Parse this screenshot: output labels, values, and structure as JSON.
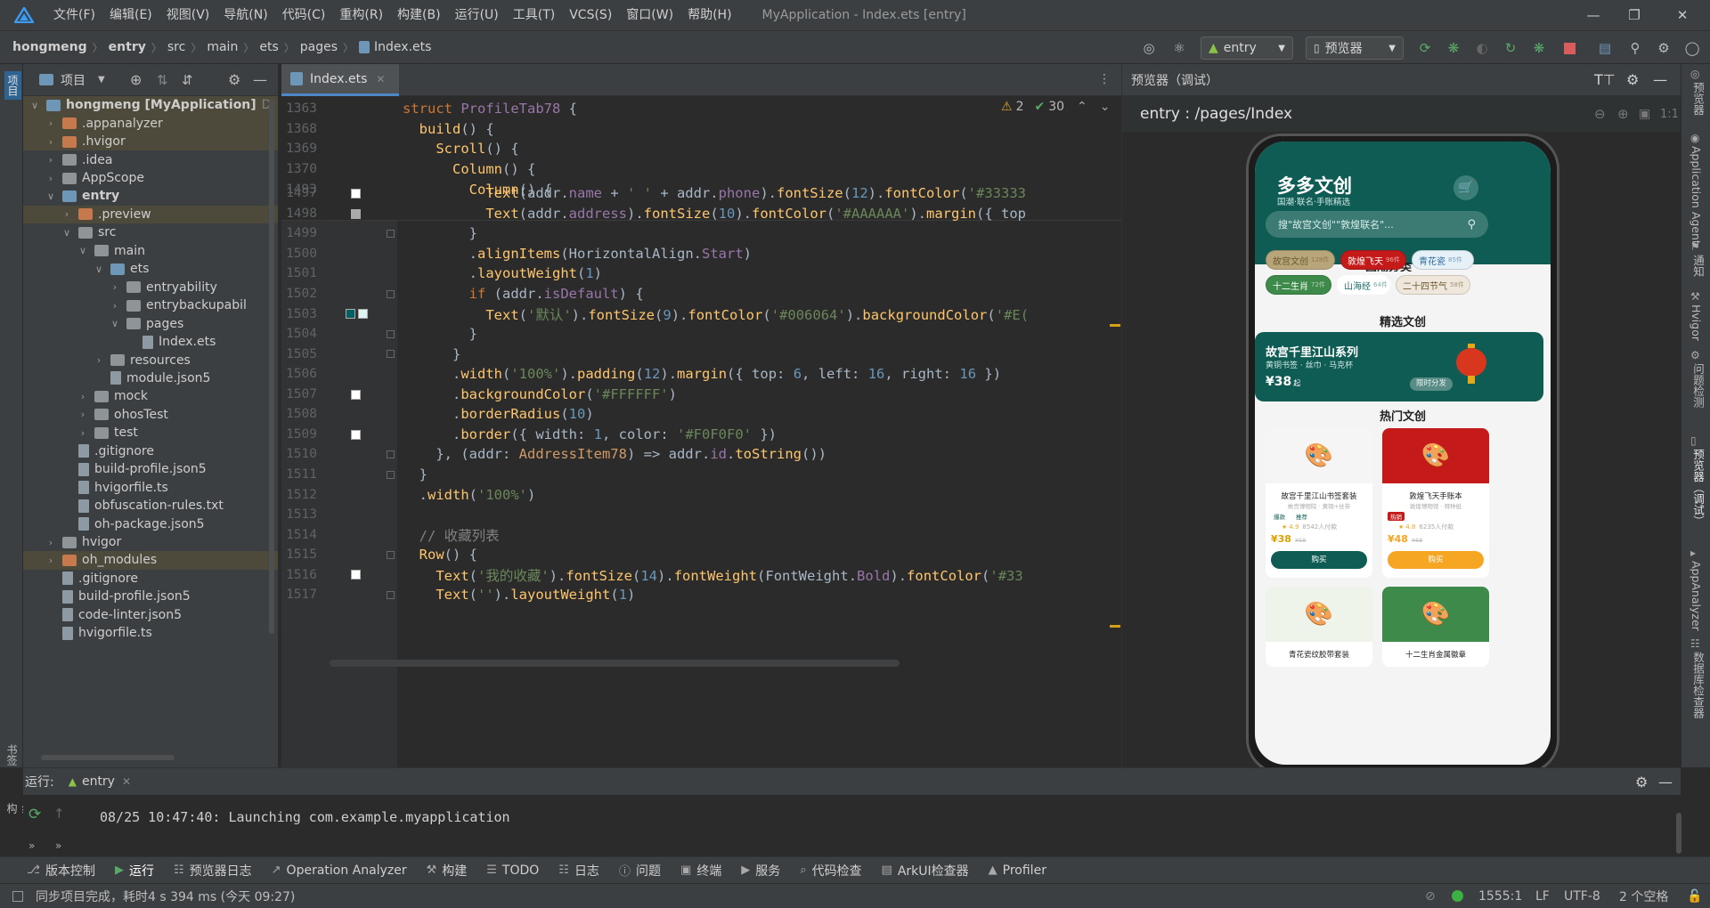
{
  "window": {
    "title": "MyApplication - Index.ets [entry]",
    "menu": [
      "文件(F)",
      "编辑(E)",
      "视图(V)",
      "导航(N)",
      "代码(C)",
      "重构(R)",
      "构建(B)",
      "运行(U)",
      "工具(T)",
      "VCS(S)",
      "窗口(W)",
      "帮助(H)"
    ]
  },
  "breadcrumbs": [
    "hongmeng",
    "entry",
    "src",
    "main",
    "ets",
    "pages",
    "Index.ets"
  ],
  "toolbar": {
    "run_config": "entry",
    "device": "预览器"
  },
  "left_strip": {
    "top_label": "项目",
    "bottom_label1": "书签",
    "bottom_label2": "结构"
  },
  "project_panel": {
    "title": "项目",
    "tree": [
      {
        "label": "hongmeng [MyApplication]",
        "suffix": "D:",
        "depth": 0,
        "expanded": true,
        "icon": "fold-blue",
        "hl": true,
        "bold": true
      },
      {
        "label": ".appanalyzer",
        "depth": 1,
        "expanded": false,
        "icon": "fold-orange",
        "hl": true
      },
      {
        "label": ".hvigor",
        "depth": 1,
        "expanded": false,
        "icon": "fold-orange",
        "hl": true
      },
      {
        "label": ".idea",
        "depth": 1,
        "expanded": false,
        "icon": "fold-gray"
      },
      {
        "label": "AppScope",
        "depth": 1,
        "expanded": false,
        "icon": "fold-gray"
      },
      {
        "label": "entry",
        "depth": 1,
        "expanded": true,
        "icon": "fold-blue",
        "bold": true
      },
      {
        "label": ".preview",
        "depth": 2,
        "expanded": false,
        "icon": "fold-orange",
        "hl": true
      },
      {
        "label": "src",
        "depth": 2,
        "expanded": true,
        "icon": "fold-gray"
      },
      {
        "label": "main",
        "depth": 3,
        "expanded": true,
        "icon": "fold-gray"
      },
      {
        "label": "ets",
        "depth": 4,
        "expanded": true,
        "icon": "fold-blue"
      },
      {
        "label": "entryability",
        "depth": 5,
        "expanded": false,
        "icon": "fold-gray"
      },
      {
        "label": "entrybackupabil",
        "depth": 5,
        "expanded": false,
        "icon": "fold-gray"
      },
      {
        "label": "pages",
        "depth": 5,
        "expanded": true,
        "icon": "fold-gray"
      },
      {
        "label": "Index.ets",
        "depth": 6,
        "leaf": true,
        "icon": "file"
      },
      {
        "label": "resources",
        "depth": 4,
        "expanded": false,
        "icon": "fold-gray"
      },
      {
        "label": "module.json5",
        "depth": 4,
        "leaf": true,
        "icon": "file"
      },
      {
        "label": "mock",
        "depth": 3,
        "expanded": false,
        "icon": "fold-gray"
      },
      {
        "label": "ohosTest",
        "depth": 3,
        "expanded": false,
        "icon": "fold-gray"
      },
      {
        "label": "test",
        "depth": 3,
        "expanded": false,
        "icon": "fold-gray"
      },
      {
        "label": ".gitignore",
        "depth": 2,
        "leaf": true,
        "icon": "file"
      },
      {
        "label": "build-profile.json5",
        "depth": 2,
        "leaf": true,
        "icon": "file"
      },
      {
        "label": "hvigorfile.ts",
        "depth": 2,
        "leaf": true,
        "icon": "file"
      },
      {
        "label": "obfuscation-rules.txt",
        "depth": 2,
        "leaf": true,
        "icon": "file"
      },
      {
        "label": "oh-package.json5",
        "depth": 2,
        "leaf": true,
        "icon": "file"
      },
      {
        "label": "hvigor",
        "depth": 1,
        "expanded": false,
        "icon": "fold-gray"
      },
      {
        "label": "oh_modules",
        "depth": 1,
        "expanded": false,
        "icon": "fold-orange",
        "hl": true
      },
      {
        "label": ".gitignore",
        "depth": 1,
        "leaf": true,
        "icon": "file"
      },
      {
        "label": "build-profile.json5",
        "depth": 1,
        "leaf": true,
        "icon": "file"
      },
      {
        "label": "code-linter.json5",
        "depth": 1,
        "leaf": true,
        "icon": "file"
      },
      {
        "label": "hvigorfile.ts",
        "depth": 1,
        "leaf": true,
        "icon": "file"
      }
    ]
  },
  "editor": {
    "tab": "Index.ets",
    "warnings": "2",
    "weak_warnings": "30",
    "sticky_lines": [
      {
        "num": "1363",
        "html": "<span class=\"kw\">struct</span> <span class=\"ty\">ProfileTab78</span> {"
      },
      {
        "num": "1368",
        "html": "  <span class=\"fn\">build</span>() {"
      },
      {
        "num": "1369",
        "html": "    <span class=\"fn\">Scroll</span>() {"
      },
      {
        "num": "1370",
        "html": "      <span class=\"fn\">Column</span>() {"
      },
      {
        "num": "1493",
        "html": "        <span class=\"fn\">Column</span>() {"
      }
    ],
    "lines": [
      {
        "num": "1497",
        "html": "          <span class=\"fn\">Text</span>(addr.<span class=\"pp\">name</span> + <span class=\"st\">' '</span> + addr.<span class=\"pp\">phone</span>).<span class=\"fn\">fontSize</span>(<span class=\"nm\">12</span>).<span class=\"fn\">fontColor</span>(<span class=\"st\">'#33333</span>"
      },
      {
        "num": "1498",
        "html": "          <span class=\"fn\">Text</span>(addr.<span class=\"pp\">address</span>).<span class=\"fn\">fontSize</span>(<span class=\"nm\">10</span>).<span class=\"fn\">fontColor</span>(<span class=\"st\">'#AAAAAA'</span>).<span class=\"fn\">margin</span>({ top"
      },
      {
        "num": "1499",
        "html": "        }"
      },
      {
        "num": "1500",
        "html": "        .<span class=\"fn\">alignItems</span>(<span class=\"pl\">HorizontalAlign</span>.<span class=\"pp\">Start</span>)"
      },
      {
        "num": "1501",
        "html": "        .<span class=\"fn\">layoutWeight</span>(<span class=\"nm\">1</span>)"
      },
      {
        "num": "1502",
        "html": "        <span class=\"kw\">if</span> (addr.<span class=\"pp\">isDefault</span>) {"
      },
      {
        "num": "1503",
        "html": "          <span class=\"fn\">Text</span>(<span class=\"st\">'默认'</span>).<span class=\"fn\">fontSize</span>(<span class=\"nm\">9</span>).<span class=\"fn\">fontColor</span>(<span class=\"st\">'#006064'</span>).<span class=\"fn\">backgroundColor</span>(<span class=\"st\">'#E(</span>"
      },
      {
        "num": "1504",
        "html": "        }"
      },
      {
        "num": "1505",
        "html": "      }"
      },
      {
        "num": "1506",
        "html": "      .<span class=\"fn\">width</span>(<span class=\"st\">'100%'</span>).<span class=\"fn\">padding</span>(<span class=\"nm\">12</span>).<span class=\"fn\">margin</span>({ top: <span class=\"nm\">6</span>, left: <span class=\"nm\">16</span>, right: <span class=\"nm\">16</span> })"
      },
      {
        "num": "1507",
        "html": "      .<span class=\"fn\">backgroundColor</span>(<span class=\"st\">'#FFFFFF'</span>)"
      },
      {
        "num": "1508",
        "html": "      .<span class=\"fn\">borderRadius</span>(<span class=\"nm\">10</span>)"
      },
      {
        "num": "1509",
        "html": "      .<span class=\"fn\">border</span>({ width: <span class=\"nm\">1</span>, color: <span class=\"st\">'#F0F0F0'</span> })"
      },
      {
        "num": "1510",
        "html": "    }, (addr: <span class=\"cl\">AddressItem78</span>) => addr.<span class=\"pp\">id</span>.<span class=\"fn\">toString</span>())"
      },
      {
        "num": "1511",
        "html": "  }"
      },
      {
        "num": "1512",
        "html": "  .<span class=\"fn\">width</span>(<span class=\"st\">'100%'</span>)"
      },
      {
        "num": "1513",
        "html": ""
      },
      {
        "num": "1514",
        "html": "  <span class=\"cm\">// 收藏列表</span>"
      },
      {
        "num": "1515",
        "html": "  <span class=\"fn\">Row</span>() {"
      },
      {
        "num": "1516",
        "html": "    <span class=\"fn\">Text</span>(<span class=\"st\">'我的收藏'</span>).<span class=\"fn\">fontSize</span>(<span class=\"nm\">14</span>).<span class=\"fn\">fontWeight</span>(<span class=\"pl\">FontWeight</span>.<span class=\"pp\">Bold</span>).<span class=\"fn\">fontColor</span>(<span class=\"st\">'#33</span>"
      },
      {
        "num": "1517",
        "html": "    <span class=\"fn\">Text</span>(<span class=\"st\">''</span>).<span class=\"fn\">layoutWeight</span>(<span class=\"nm\">1</span>)"
      }
    ]
  },
  "preview": {
    "title": "预览器（调试）",
    "path": "entry : /pages/Index",
    "app": {
      "brand": "多多文创",
      "tagline": "国潮·联名·手账精选",
      "search_placeholder": "搜\"故宫文创\"\"敦煌联名\"...",
      "tag_row1": [
        {
          "label": "故宫文创",
          "count": "128件",
          "bg": "#b8a57a",
          "fg": "#6b5a2e"
        },
        {
          "label": "敦煌飞天",
          "count": "96件",
          "bg": "#c41a1a",
          "fg": "#ffffff"
        },
        {
          "label": "青花瓷",
          "count": "85件",
          "bg": "#e6f0f7",
          "fg": "#2e6d9e"
        }
      ],
      "tag_row2": [
        {
          "label": "十二生肖",
          "count": "72件",
          "bg": "#3d8a4a",
          "fg": "#ffffff"
        },
        {
          "label": "山海经",
          "count": "64件",
          "bg": "#ffffff",
          "fg": "#1a6e66"
        },
        {
          "label": "二十四节气",
          "count": "58件",
          "bg": "#efe7dc",
          "fg": "#6b5a2e"
        }
      ],
      "section_featured": "精选文创",
      "banner": {
        "title": "故宫千里江山系列",
        "subtitle": "黄铜书签 · 丝巾 · 马克杯",
        "price": "¥38",
        "price_suffix": "起",
        "badge": "限时分发"
      },
      "section_hot": "热门文创",
      "products": [
        {
          "name": "故宫千里江山书签套装",
          "desc": "故宫博物院 · 黄铜+丝带",
          "tags": [
            "爆款",
            "推荐"
          ],
          "rating": "4.9",
          "sold": "8542人付款",
          "price": "¥38",
          "orig": "¥58",
          "button": "购买",
          "img_bg": "#f5f5f5",
          "btn_bg": "#0f5c55"
        },
        {
          "name": "敦煌飞天手账本",
          "desc": "敦煌博物馆 · 特种纸",
          "tags": [
            "热销"
          ],
          "rating": "4.8",
          "sold": "6235人付款",
          "price": "¥48",
          "orig": "¥68",
          "button": "购买",
          "img_bg": "#c41a1a",
          "btn_bg": "#f5a623"
        },
        {
          "name": "青花瓷纹胶带套装",
          "img_bg": "#eef4ea"
        },
        {
          "name": "十二生肖金属徽章",
          "img_bg": "#3d8a4a"
        }
      ]
    }
  },
  "right_strip": [
    "预览器",
    "Application Agent",
    "通知",
    "Hvigor",
    "问题检测",
    "预览器（调试）",
    "AppAnalyzer",
    "数据库检查器"
  ],
  "run_panel": {
    "label": "运行:",
    "config": "entry",
    "log": "08/25 10:47:40: Launching com.example.myapplication"
  },
  "bottom_tools": [
    "版本控制",
    "运行",
    "预览器日志",
    "Operation Analyzer",
    "构建",
    "TODO",
    "日志",
    "问题",
    "终端",
    "服务",
    "代码检查",
    "ArkUI检查器",
    "Profiler"
  ],
  "status": {
    "message": "同步项目完成，耗时4 s 394 ms (今天 09:27)",
    "position": "1555:1",
    "line_sep": "LF",
    "encoding": "UTF-8",
    "indent": "2 个空格"
  }
}
